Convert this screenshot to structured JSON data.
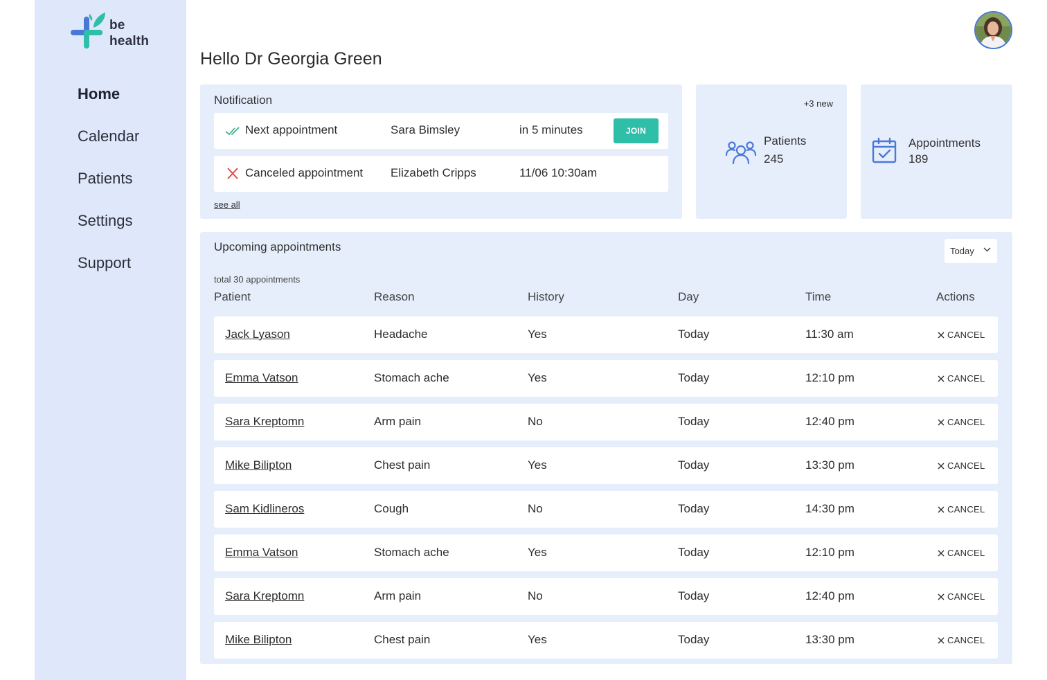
{
  "brand": {
    "line1": "be",
    "line2": "health"
  },
  "nav": [
    {
      "label": "Home",
      "active": true
    },
    {
      "label": "Calendar"
    },
    {
      "label": "Patients"
    },
    {
      "label": "Settings"
    },
    {
      "label": "Support"
    }
  ],
  "user": {
    "avatar_icon": "doctor-avatar"
  },
  "greeting": "Hello Dr Georgia Green",
  "notifications": {
    "title": "Notification",
    "items": [
      {
        "icon": "double-check-icon",
        "label": "Next appointment",
        "name": "Sara Bimsley",
        "when": "in 5 minutes",
        "action": "JOIN"
      },
      {
        "icon": "x-icon",
        "label": "Canceled appointment",
        "name": "Elizabeth Cripps",
        "when": "11/06 10:30am"
      }
    ],
    "see_all": "see all"
  },
  "stats": {
    "patients": {
      "badge": "+3 new",
      "label": "Patients",
      "value": "245",
      "icon": "users-icon"
    },
    "appointments": {
      "label": "Appointments",
      "value": "189",
      "icon": "calendar-check-icon"
    }
  },
  "upcoming": {
    "title": "Upcoming appointments",
    "filter": "Today",
    "total": "total 30 appointments",
    "columns": [
      "Patient",
      "Reason",
      "History",
      "Day",
      "Time",
      "Actions"
    ],
    "rows": [
      {
        "patient": "Jack Lyason",
        "reason": "Headache",
        "history": "Yes",
        "day": "Today",
        "time": "11:30 am",
        "action": "CANCEL"
      },
      {
        "patient": "Emma Vatson",
        "reason": "Stomach ache",
        "history": "Yes",
        "day": "Today",
        "time": "12:10 pm",
        "action": "CANCEL"
      },
      {
        "patient": "Sara Kreptomn",
        "reason": "Arm pain",
        "history": "No",
        "day": "Today",
        "time": "12:40 pm",
        "action": "CANCEL"
      },
      {
        "patient": "Mike Bilipton",
        "reason": "Chest pain",
        "history": "Yes",
        "day": "Today",
        "time": "13:30 pm",
        "action": "CANCEL"
      },
      {
        "patient": "Sam Kidlineros",
        "reason": "Cough",
        "history": "No",
        "day": "Today",
        "time": "14:30 pm",
        "action": "CANCEL"
      },
      {
        "patient": "Emma Vatson",
        "reason": "Stomach ache",
        "history": "Yes",
        "day": "Today",
        "time": "12:10 pm",
        "action": "CANCEL"
      },
      {
        "patient": "Sara Kreptomn",
        "reason": "Arm pain",
        "history": "No",
        "day": "Today",
        "time": "12:40 pm",
        "action": "CANCEL"
      },
      {
        "patient": "Mike Bilipton",
        "reason": "Chest pain",
        "history": "Yes",
        "day": "Today",
        "time": "13:30 pm",
        "action": "CANCEL"
      }
    ]
  },
  "colors": {
    "sidebar": "#dfe8fb",
    "card": "#e6eefc",
    "accent": "#2fbfa9",
    "icon_blue": "#4a78d8",
    "cancel_red": "#e0403a"
  }
}
